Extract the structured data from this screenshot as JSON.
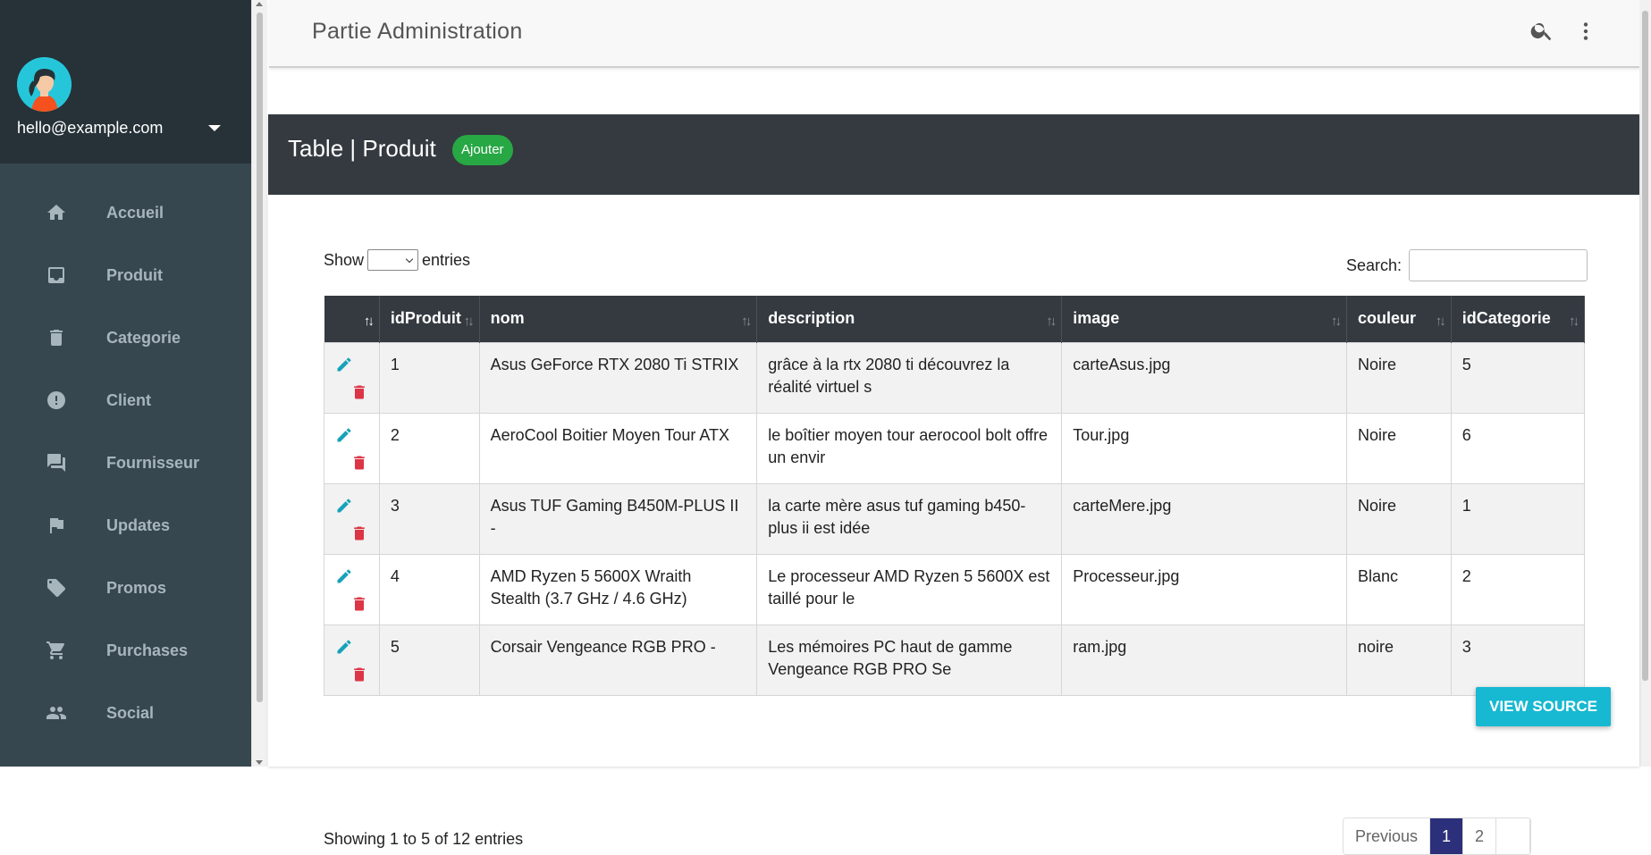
{
  "user": {
    "email": "hello@example.com"
  },
  "nav": [
    {
      "label": "Accueil",
      "icon": "home-icon"
    },
    {
      "label": "Produit",
      "icon": "inbox-icon"
    },
    {
      "label": "Categorie",
      "icon": "trash-icon"
    },
    {
      "label": "Client",
      "icon": "alert-icon"
    },
    {
      "label": "Fournisseur",
      "icon": "forum-icon"
    },
    {
      "label": "Updates",
      "icon": "flag-icon"
    },
    {
      "label": "Promos",
      "icon": "tag-icon"
    },
    {
      "label": "Purchases",
      "icon": "cart-icon"
    },
    {
      "label": "Social",
      "icon": "people-icon"
    }
  ],
  "topbar": {
    "title": "Partie Administration"
  },
  "card": {
    "title": "Table | Produit",
    "add_label": "Ajouter"
  },
  "table": {
    "length_show": "Show",
    "length_entries": "entries",
    "search_label": "Search:",
    "search_value": "",
    "columns": [
      "idProduit",
      "nom",
      "description",
      "image",
      "couleur",
      "idCategorie"
    ],
    "rows": [
      {
        "id": "1",
        "nom": "Asus GeForce RTX 2080 Ti STRIX",
        "description": "grâce à la rtx 2080 ti découvrez la réalité virtuel s",
        "image": "carteAsus.jpg",
        "couleur": "Noire",
        "cat": "5"
      },
      {
        "id": "2",
        "nom": "AeroCool Boitier Moyen Tour ATX",
        "description": "le boîtier moyen tour aerocool bolt offre un envir",
        "image": "Tour.jpg",
        "couleur": "Noire",
        "cat": "6"
      },
      {
        "id": "3",
        "nom": "Asus TUF Gaming B450M-PLUS II -",
        "description": "la carte mère asus tuf gaming b450-plus ii est idée",
        "image": "carteMere.jpg",
        "couleur": "Noire",
        "cat": "1"
      },
      {
        "id": "4",
        "nom": "AMD Ryzen 5 5600X Wraith Stealth (3.7 GHz / 4.6 GHz)",
        "description": "Le processeur AMD Ryzen 5 5600X est taillé pour le",
        "image": "Processeur.jpg",
        "couleur": "Blanc",
        "cat": "2"
      },
      {
        "id": "5",
        "nom": "Corsair Vengeance RGB PRO -",
        "description": "Les mémoires PC haut de gamme Vengeance RGB PRO Se",
        "image": "ram.jpg",
        "couleur": "noire",
        "cat": "3"
      }
    ],
    "info": "Showing 1 to 5 of 12 entries",
    "pagination": {
      "previous": "Previous",
      "pages": [
        "1",
        "2"
      ],
      "current": "1"
    }
  },
  "view_source_label": "VIEW SOURCE",
  "colors": {
    "sidebar": "#37474f",
    "header": "#343a40",
    "accent_green": "#28a745",
    "accent_cyan": "#17b8d1",
    "edit": "#17a2b8",
    "delete": "#dc3545"
  }
}
